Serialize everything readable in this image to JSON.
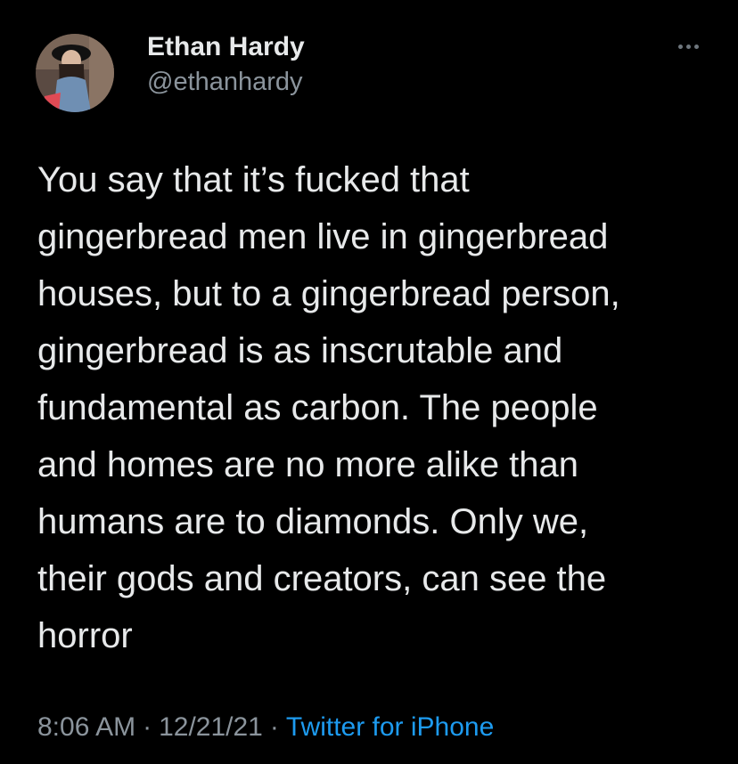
{
  "colors": {
    "background": "#000000",
    "text_primary": "#e7e9ea",
    "text_secondary": "#8b949c",
    "link": "#1d9bf0"
  },
  "author": {
    "display_name": "Ethan Hardy",
    "handle": "@ethanhardy",
    "avatar_icon": "profile-photo"
  },
  "menu": {
    "icon": "more-horizontal-icon"
  },
  "tweet": {
    "text": "You say that it’s fucked that\ngingerbread men live in gingerbread\nhouses, but to a gingerbread person,\ngingerbread is as inscrutable and\nfundamental as carbon. The people\nand homes are no more alike than\nhumans are to diamonds. Only we,\ntheir gods and creators, can see the\nhorror",
    "time": "8:06 AM",
    "date": "12/21/21",
    "separator": "·",
    "source": "Twitter for iPhone"
  }
}
